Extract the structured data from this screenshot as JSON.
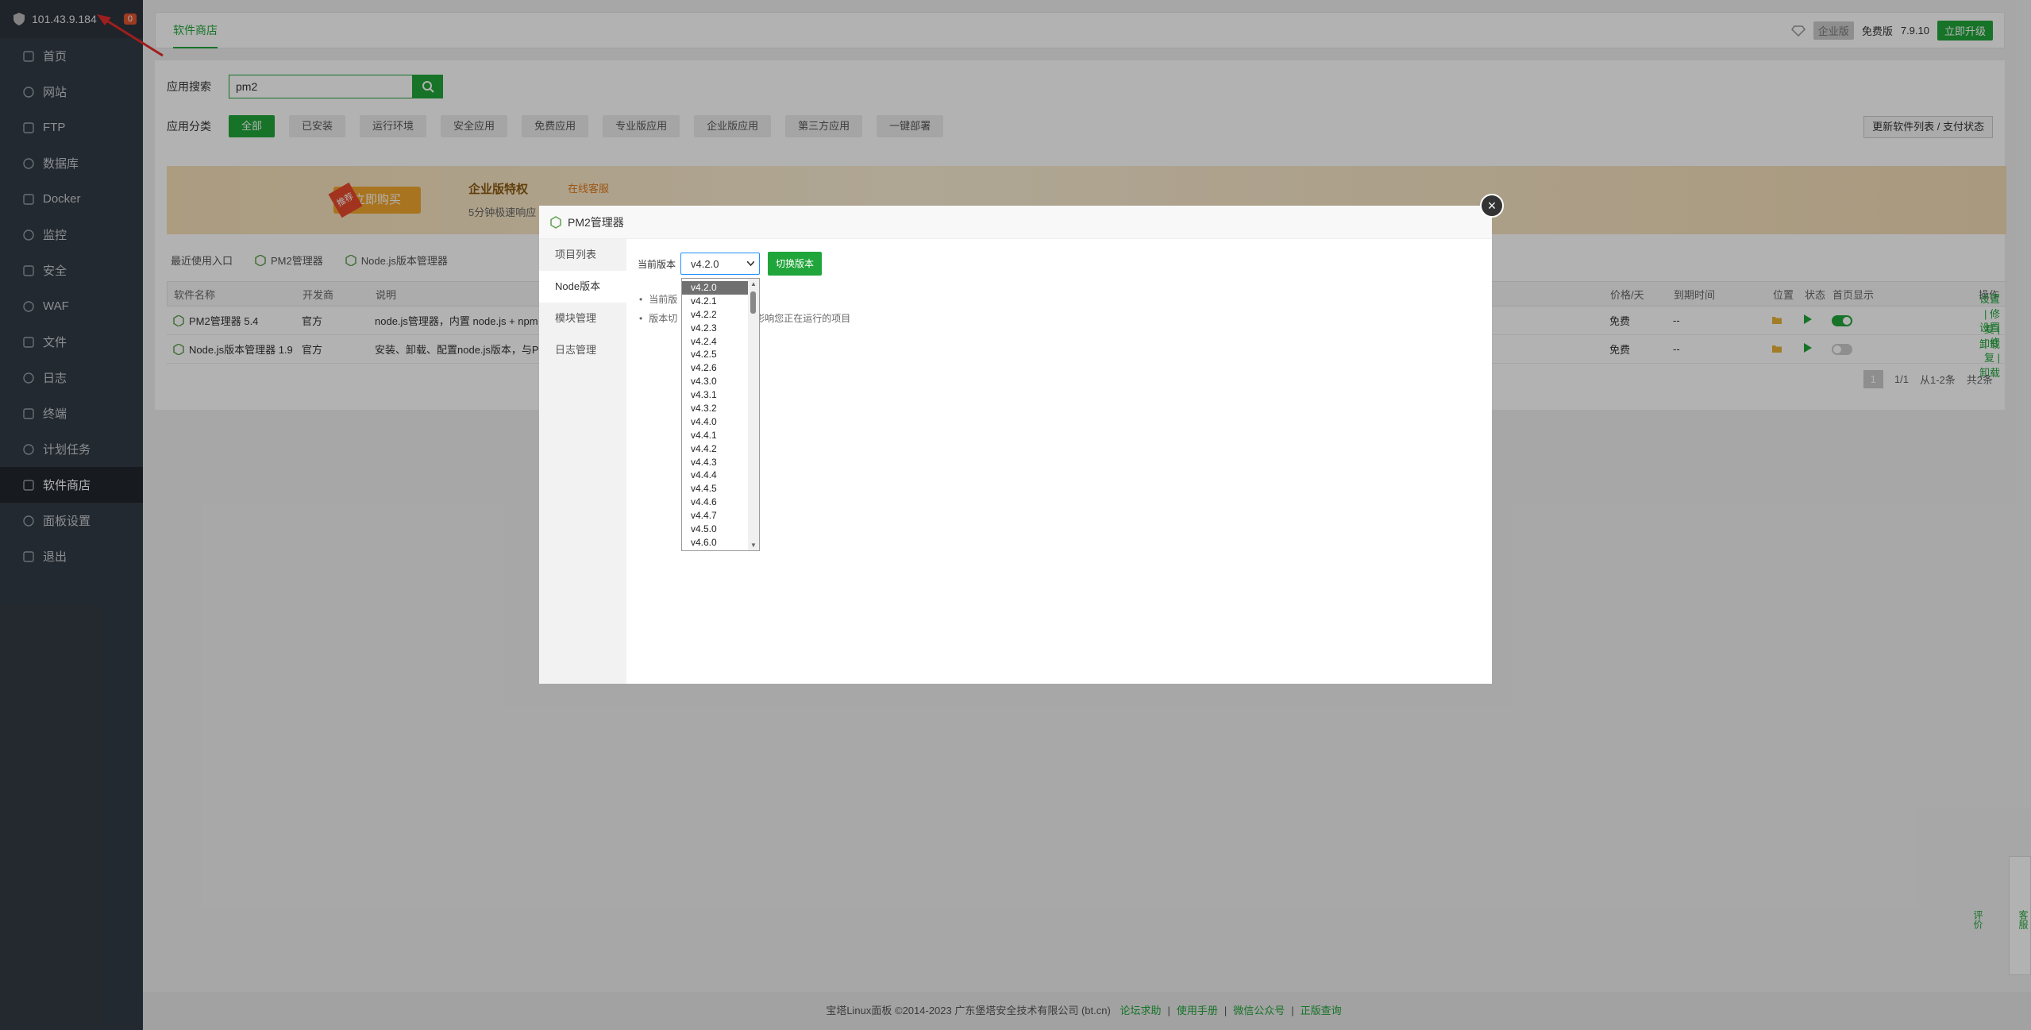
{
  "sidebar": {
    "ip": "101.43.9.184",
    "badge": "0",
    "items": [
      {
        "label": "首页"
      },
      {
        "label": "网站"
      },
      {
        "label": "FTP"
      },
      {
        "label": "数据库"
      },
      {
        "label": "Docker"
      },
      {
        "label": "监控"
      },
      {
        "label": "安全"
      },
      {
        "label": "WAF"
      },
      {
        "label": "文件"
      },
      {
        "label": "日志"
      },
      {
        "label": "终端"
      },
      {
        "label": "计划任务"
      },
      {
        "label": "软件商店"
      },
      {
        "label": "面板设置"
      },
      {
        "label": "退出"
      }
    ]
  },
  "topbar": {
    "tab": "软件商店",
    "enterprise": "企业版",
    "free": "免费版",
    "version": "7.9.10",
    "upgrade": "立即升级"
  },
  "search": {
    "label": "应用搜索",
    "value": "pm2"
  },
  "categories": {
    "label": "应用分类",
    "items": [
      "全部",
      "已安装",
      "运行环境",
      "安全应用",
      "免费应用",
      "专业版应用",
      "企业版应用",
      "第三方应用",
      "一键部署"
    ]
  },
  "update_button": "更新软件列表 / 支付状态",
  "banner": {
    "hot": "推荐",
    "buy": "立即购买",
    "title": "企业版特权",
    "online": "在线客服",
    "quick": "5分钟极速响应"
  },
  "recent": {
    "label": "最近使用入口",
    "items": [
      "PM2管理器",
      "Node.js版本管理器"
    ]
  },
  "table": {
    "headers": {
      "name": "软件名称",
      "dev": "开发商",
      "desc": "说明",
      "price": "价格/天",
      "expire": "到期时间",
      "pos": "位置",
      "status": "状态",
      "home": "首页显示",
      "op": "操作"
    },
    "rows": [
      {
        "name": "PM2管理器 5.4",
        "dev": "官方",
        "desc": "node.js管理器，内置 node.js + npm",
        "price": "免费",
        "expire": "--",
        "op": "设置 | 修复 | 卸载"
      },
      {
        "name": "Node.js版本管理器 1.9",
        "dev": "官方",
        "desc": "安装、卸载、配置node.js版本，与PM",
        "price": "免费",
        "expire": "--",
        "op": "设置 | 修复 | 卸载"
      }
    ]
  },
  "pager": {
    "page": "1",
    "total_pages": "1/1",
    "range": "从1-2条",
    "count": "共2条"
  },
  "footer": {
    "copyright": "宝塔Linux面板 ©2014-2023 广东堡塔安全技术有限公司 (bt.cn)",
    "links": [
      "论坛求助",
      "使用手册",
      "微信公众号",
      "正版查询"
    ]
  },
  "float": {
    "service": "客服",
    "review": "评价"
  },
  "modal": {
    "title": "PM2管理器",
    "tabs": [
      "项目列表",
      "Node版本",
      "模块管理",
      "日志管理"
    ],
    "current_label": "当前版本",
    "current_value": "v4.2.0",
    "switch_label": "切换版本",
    "notes": [
      "当前版",
      "版本切",
      "本后可能影响您正在运行的项目"
    ]
  },
  "dropdown": {
    "options": [
      "v4.2.0",
      "v4.2.1",
      "v4.2.2",
      "v4.2.3",
      "v4.2.4",
      "v4.2.5",
      "v4.2.6",
      "v4.3.0",
      "v4.3.1",
      "v4.3.2",
      "v4.4.0",
      "v4.4.1",
      "v4.4.2",
      "v4.4.3",
      "v4.4.4",
      "v4.4.5",
      "v4.4.6",
      "v4.4.7",
      "v4.5.0",
      "v4.6.0"
    ],
    "selected": "v4.2.0"
  },
  "colors": {
    "accent": "#20a53a",
    "sidebar": "#333b45",
    "badge": "#e05530",
    "annotation": "#e52b2b"
  }
}
